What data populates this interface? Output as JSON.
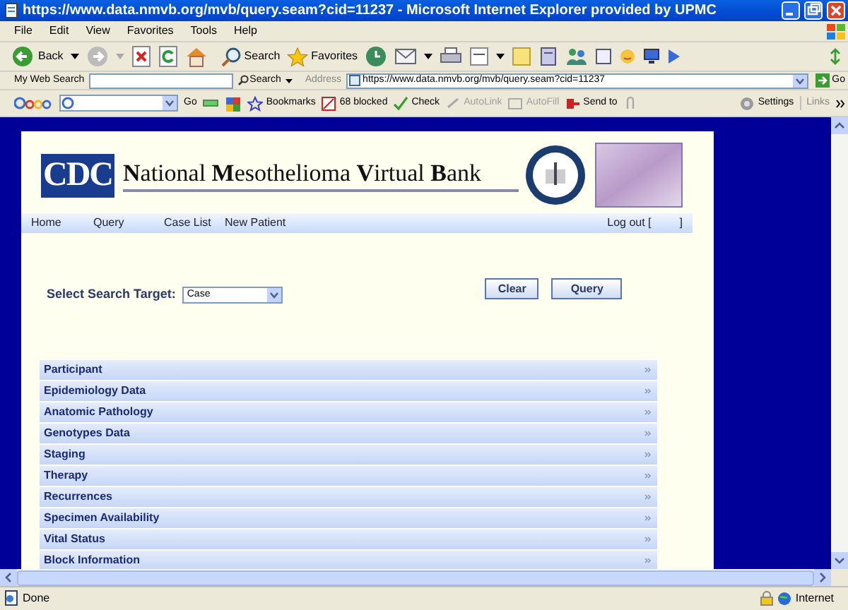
{
  "window": {
    "title": "https://www.data.nmvb.org/mvb/query.seam?cid=11237 - Microsoft Internet Explorer provided by UPMC"
  },
  "menu": [
    "File",
    "Edit",
    "View",
    "Favorites",
    "Tools",
    "Help"
  ],
  "toolbar": {
    "back": "Back",
    "search": "Search",
    "favorites": "Favorites"
  },
  "address_bar": {
    "web_search_label": "My Web Search",
    "search_button": "Search",
    "address_label": "Address",
    "url": "https://www.data.nmvb.org/mvb/query.seam?cid=11237",
    "go": "Go"
  },
  "google_bar": [
    {
      "label": "Go",
      "disabled": false
    },
    {
      "label": "Bookmarks",
      "disabled": false
    },
    {
      "label": "68 blocked",
      "disabled": false
    },
    {
      "label": "Check",
      "disabled": false
    },
    {
      "label": "AutoLink",
      "disabled": true
    },
    {
      "label": "AutoFill",
      "disabled": true
    },
    {
      "label": "Send to",
      "disabled": false
    },
    {
      "label": "Settings",
      "disabled": false
    }
  ],
  "links_label": "Links",
  "page": {
    "logo": "CDC",
    "site_title": "**N**ational **M**esothelioma **V**irtual **B**ank",
    "nav": [
      "Home",
      "Query",
      "Case List",
      "New Patient"
    ],
    "logout": "Log out [",
    "logout_end": "]",
    "search_label": "Select Search Target:",
    "search_target": "Case",
    "buttons": [
      "Clear",
      "Query"
    ],
    "sections": [
      {
        "label": "Participant"
      },
      {
        "label": "Epidemiology Data"
      },
      {
        "label": "Anatomic Pathology"
      },
      {
        "label": "Genotypes Data"
      },
      {
        "label": "Staging"
      },
      {
        "label": "Therapy"
      },
      {
        "label": "Recurrences"
      },
      {
        "label": "Specimen Availability"
      },
      {
        "label": "Vital Status"
      },
      {
        "label": "Block Information"
      }
    ]
  },
  "status_bar": {
    "text": "Done",
    "zone": "Internet"
  }
}
